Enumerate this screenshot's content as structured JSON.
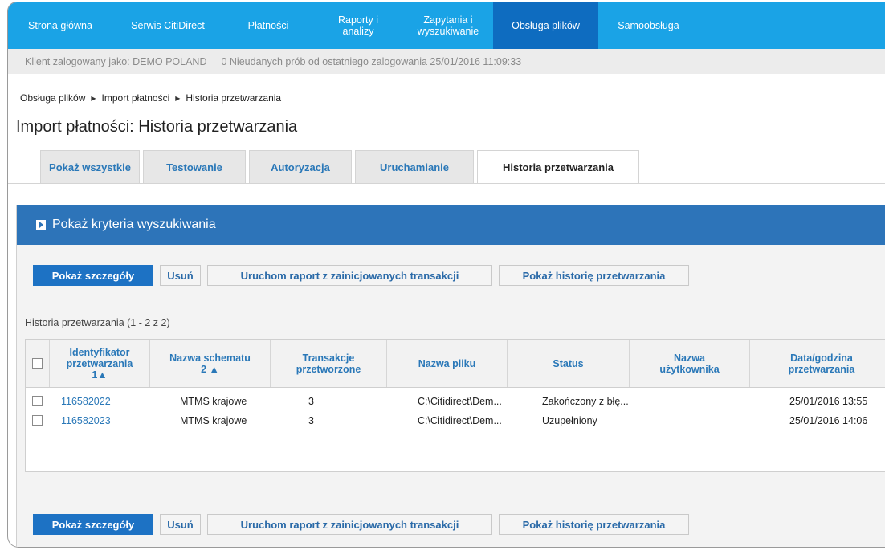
{
  "nav": {
    "items": [
      "Strona główna",
      "Serwis CitiDirect",
      "Płatności",
      "Raporty i\nanalizy",
      "Zapytania i\nwyszukiwanie",
      "Obsługa plików",
      "Samoobsługa"
    ],
    "active_index": 5
  },
  "info": {
    "logged_in": "Klient zalogowany jako: DEMO POLAND",
    "failed": "0 Nieudanych prób od ostatniego zalogowania 25/01/2016 11:09:33"
  },
  "breadcrumb": [
    "Obsługa plików",
    "Import płatności",
    "Historia przetwarzania"
  ],
  "page_title": "Import płatności: Historia przetwarzania",
  "tabs": [
    "Pokaż wszystkie",
    "Testowanie",
    "Autoryzacja",
    "Uruchamianie",
    "Historia przetwarzania"
  ],
  "active_tab": 4,
  "search": {
    "label": "Pokaż kryteria wyszukiwania"
  },
  "buttons": {
    "details": "Pokaż szczegóły",
    "delete": "Usuń",
    "run_report": "Uruchom raport z zainicjowanych transakcji",
    "show_history": "Pokaż historię przetwarzania"
  },
  "table": {
    "count_label": "Historia przetwarzania (1 - 2 z 2)",
    "headers": [
      "Identyfikator\nprzetwarzania\n1▲",
      "Nazwa schematu\n2 ▲",
      "Transakcje\nprzetworzone",
      "Nazwa pliku",
      "Status",
      "Nazwa\nużytkownika",
      "Data/godzina\nprzetwarzania"
    ],
    "rows": [
      [
        "116582022",
        "MTMS krajowe",
        "3",
        "C:\\Citidirect\\Dem...",
        "Zakończony z błę...",
        "",
        "25/01/2016 13:55"
      ],
      [
        "116582023",
        "MTMS krajowe",
        "3",
        "C:\\Citidirect\\Dem...",
        "Uzupełniony",
        "",
        "25/01/2016 14:06"
      ]
    ]
  },
  "colors": {
    "nav": "#1aa3e6",
    "nav_active": "#0e6cc0",
    "panel_header": "#2d74b9",
    "primary_button": "#1d72c4",
    "link": "#2a78b8"
  }
}
